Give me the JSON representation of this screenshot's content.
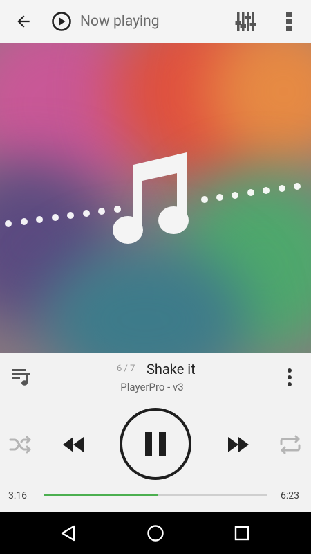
{
  "toolbar": {
    "title": "Now playing",
    "icons": [
      "back-arrow-icon",
      "play-circle-icon",
      "equalizer-icon",
      "more-vert-icon"
    ]
  },
  "artwork": {
    "icon": "music-note-icon",
    "colors": [
      "#c5568f",
      "#e3553f",
      "#e4793e",
      "#4fa36a",
      "#3a6b8c",
      "#6a4a78"
    ]
  },
  "track": {
    "position": "6 / 7",
    "title": "Shake it",
    "artist": "PlayerPro - v3"
  },
  "controls": {
    "icons": [
      "shuffle-icon",
      "rewind-icon",
      "pause-icon",
      "fast-forward-icon",
      "repeat-icon"
    ],
    "state": "playing"
  },
  "progress": {
    "current_time": "3:16",
    "total_time": "6:23",
    "fraction": 0.51,
    "accent": "#4caf50"
  },
  "navbar": {
    "icons": [
      "nav-back-icon",
      "nav-home-icon",
      "nav-recents-icon"
    ]
  }
}
